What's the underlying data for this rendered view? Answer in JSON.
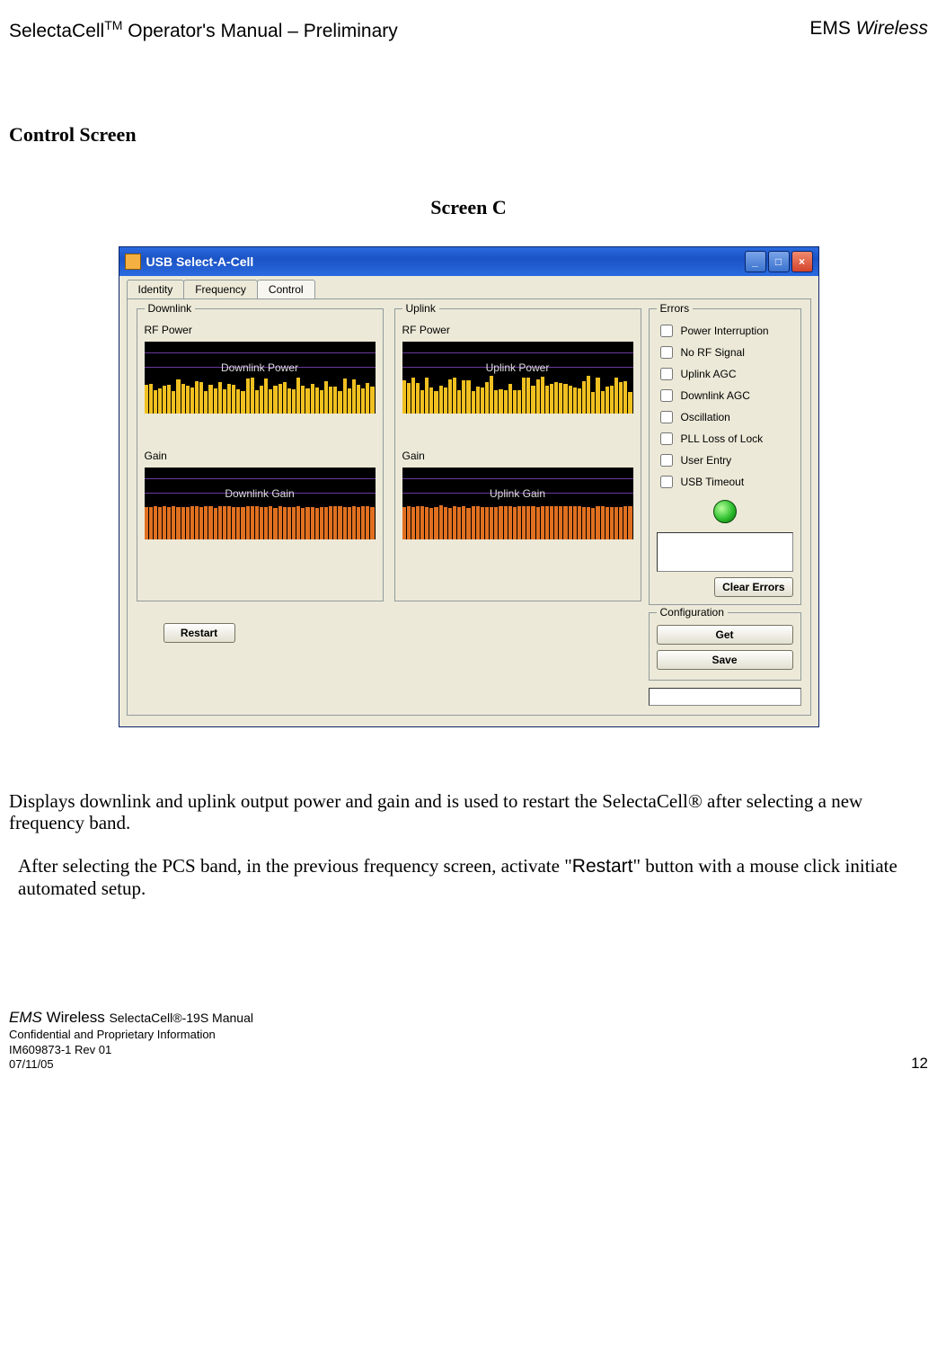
{
  "header": {
    "left_pre": "SelectaCell",
    "left_sup": "TM",
    "left_post": " Operator's Manual – Preliminary",
    "right_pre": "EMS ",
    "right_em": "Wireless"
  },
  "section_heading": "Control Screen",
  "screen_label": "Screen C",
  "window": {
    "title": "USB Select-A-Cell",
    "tabs": [
      "Identity",
      "Frequency",
      "Control"
    ],
    "active_tab_index": 2,
    "downlink_legend": "Downlink",
    "uplink_legend": "Uplink",
    "rf_power_label": "RF Power",
    "gain_label": "Gain",
    "restart_btn": "Restart",
    "errors_legend": "Errors",
    "errors_items": [
      "Power Interruption",
      "No RF Signal",
      "Uplink AGC",
      "Downlink AGC",
      "Oscillation",
      "PLL Loss of Lock",
      "User Entry",
      "USB Timeout"
    ],
    "clear_errors_btn": "Clear Errors",
    "config_legend": "Configuration",
    "get_btn": "Get",
    "save_btn": "Save"
  },
  "chart_data": [
    {
      "type": "bar",
      "title": "Downlink Power",
      "categories_count": 50,
      "series": [
        {
          "name": "Downlink Power",
          "values_approx": "varying 30-45% height, yellow bars"
        }
      ],
      "xlabel": "",
      "ylabel": "",
      "color": "yellow"
    },
    {
      "type": "bar",
      "title": "Uplink Power",
      "categories_count": 50,
      "series": [
        {
          "name": "Uplink Power",
          "values_approx": "varying 30-50% height, yellow bars"
        }
      ],
      "xlabel": "",
      "ylabel": "",
      "color": "yellow"
    },
    {
      "type": "bar",
      "title": "Downlink Gain",
      "categories_count": 50,
      "series": [
        {
          "name": "Downlink Gain",
          "values_approx": "uniform ~45% height, orange bars"
        }
      ],
      "xlabel": "",
      "ylabel": "",
      "color": "orange"
    },
    {
      "type": "bar",
      "title": "Uplink Gain",
      "categories_count": 50,
      "series": [
        {
          "name": "Uplink Gain",
          "values_approx": "uniform ~45% height, orange bars"
        }
      ],
      "xlabel": "",
      "ylabel": "",
      "color": "orange"
    }
  ],
  "paragraph1": "Displays downlink and uplink output power and gain and is used to restart the SelectaCell® after selecting a new frequency band.",
  "paragraph2_pre": "After selecting the PCS band, in the previous frequency screen, activate \"",
  "paragraph2_restart": "Restart",
  "paragraph2_post": "\" button with a mouse click initiate automated setup.",
  "footer": {
    "line1_pre": "EMS",
    "line1_mid": " Wireless ",
    "line1_post_pre": "SelectaCell®-19S",
    "line1_post_post": " Manual",
    "line2": "Confidential and Proprietary Information",
    "line3": "IM609873-1 Rev 01",
    "line4": "07/11/05",
    "page_num": "12"
  }
}
